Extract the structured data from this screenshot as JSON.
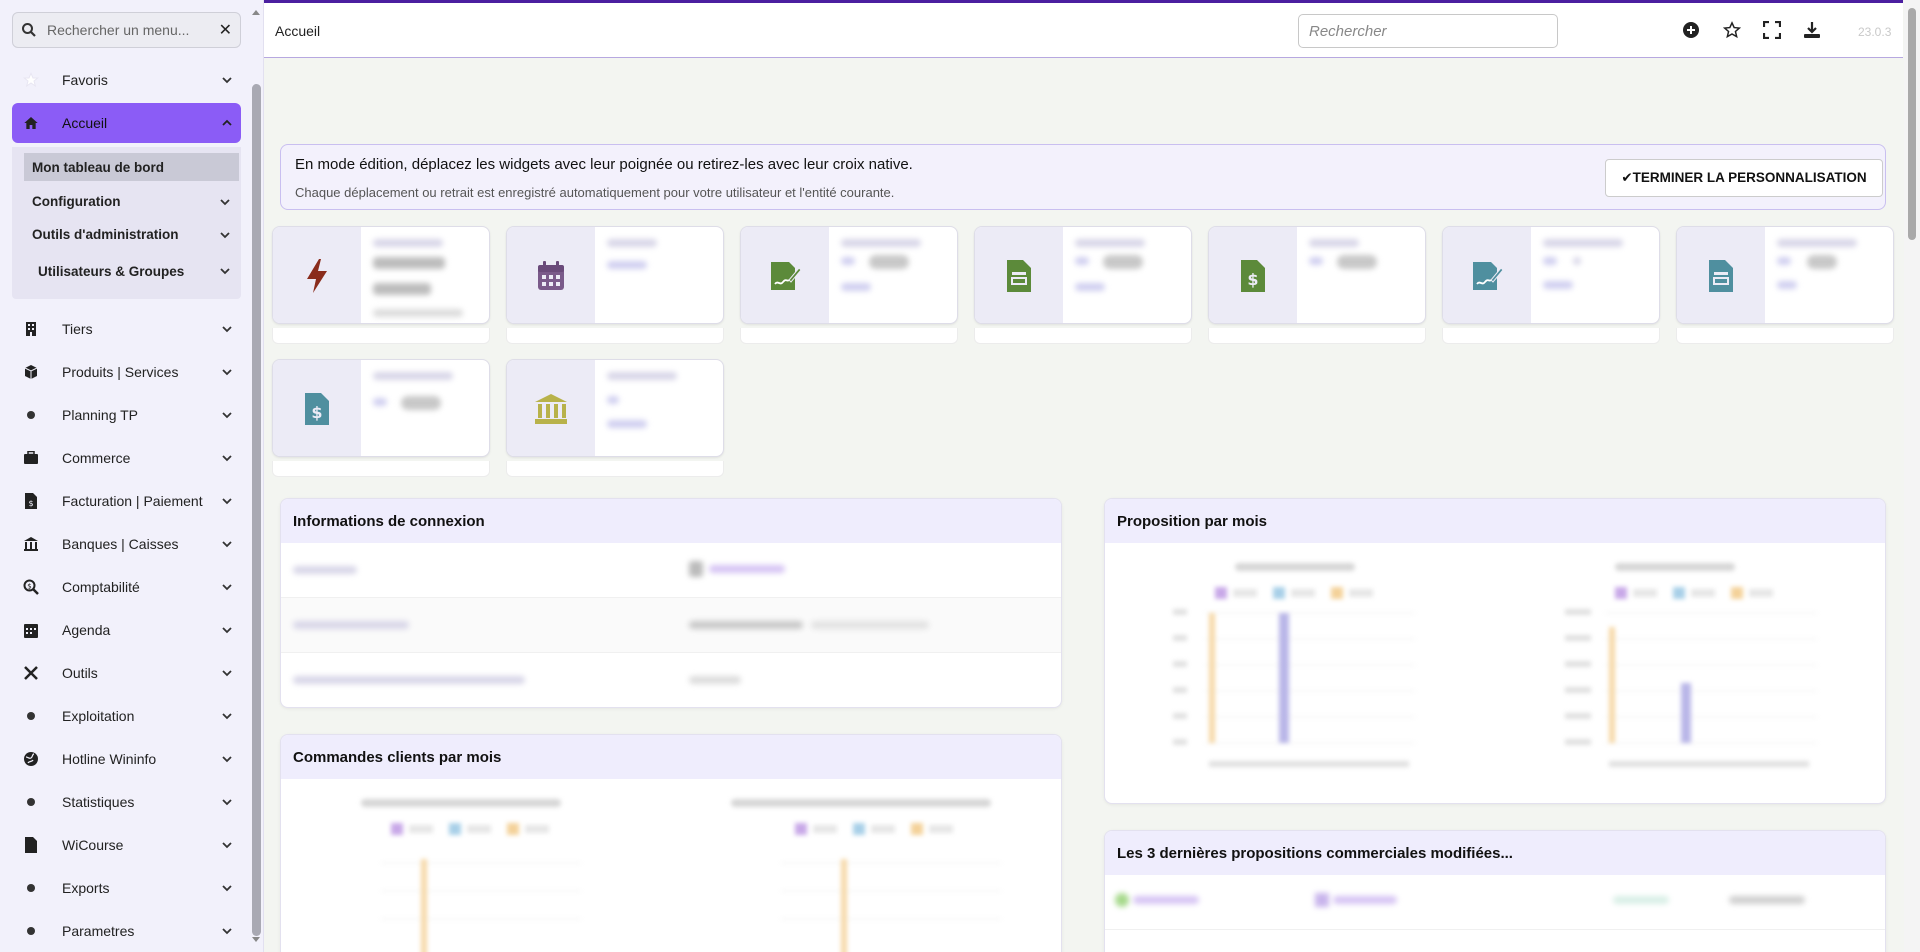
{
  "sidebar": {
    "search_placeholder": "Rechercher un menu...",
    "items": [
      {
        "label": "Favoris",
        "icon": "star-icon"
      },
      {
        "label": "Accueil",
        "icon": "home-icon",
        "active": true
      },
      {
        "label": "Tiers",
        "icon": "building-icon"
      },
      {
        "label": "Produits | Services",
        "icon": "box-icon"
      },
      {
        "label": "Planning TP",
        "icon": "dot-icon"
      },
      {
        "label": "Commerce",
        "icon": "briefcase-icon"
      },
      {
        "label": "Facturation | Paiement",
        "icon": "invoice-icon"
      },
      {
        "label": "Banques | Caisses",
        "icon": "bank-icon"
      },
      {
        "label": "Comptabilité",
        "icon": "search-dollar-icon"
      },
      {
        "label": "Agenda",
        "icon": "calendar-icon"
      },
      {
        "label": "Outils",
        "icon": "tools-icon"
      },
      {
        "label": "Exploitation",
        "icon": "dot-icon"
      },
      {
        "label": "Hotline Wininfo",
        "icon": "globe-icon"
      },
      {
        "label": "Statistiques",
        "icon": "dot-icon"
      },
      {
        "label": "WiCourse",
        "icon": "file-icon"
      },
      {
        "label": "Exports",
        "icon": "dot-icon"
      },
      {
        "label": "Parametres",
        "icon": "dot-icon"
      }
    ],
    "accueil_sub": [
      {
        "label": "Mon tableau de bord"
      },
      {
        "label": "Configuration"
      },
      {
        "label": "Outils d'administration"
      },
      {
        "label": "Utilisateurs & Groupes"
      }
    ]
  },
  "topbar": {
    "breadcrumb": "Accueil",
    "search_placeholder": "Rechercher",
    "version": "23.0.3"
  },
  "notice": {
    "title": "En mode édition, déplacez les widgets avec leur poignée ou retirez-les avec leur croix native.",
    "subtitle": "Chaque déplacement ou retrait est enregistré automatiquement pour votre utilisateur et l'entité courante.",
    "button": "✔TERMINER LA PERSONNALISATION"
  },
  "colors": {
    "accent": "#8b5cf6",
    "topbar_border": "#4b1fa0",
    "bolt": "#8a2c1c",
    "calendar": "#7a5a8a",
    "green": "#5c8a3a",
    "teal": "#4f8f9f",
    "olive": "#b8b24a"
  },
  "panels": {
    "connexion_title": "Informations de connexion",
    "proposition_title": "Proposition par mois",
    "commandes_title": "Commandes clients par mois",
    "dernieres_title": "Les 3 dernières propositions commerciales modifiées..."
  }
}
